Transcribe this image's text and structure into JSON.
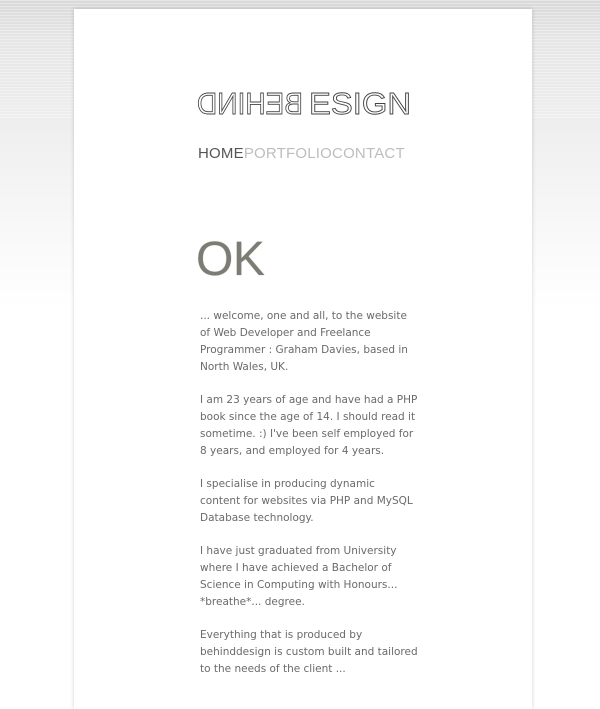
{
  "logo": {
    "mirrored_part": "BEHIND",
    "normal_part": "ESIGN"
  },
  "nav": {
    "items": [
      {
        "label": "HOME",
        "active": true
      },
      {
        "label": "PORTFOLIO",
        "active": false
      },
      {
        "label": "CONTACT",
        "active": false
      }
    ]
  },
  "main": {
    "heading": "OK",
    "paragraphs": [
      "... welcome, one and all, to the website of Web Developer and Freelance Programmer : Graham Davies, based in North Wales, UK.",
      "I am 23 years of age and have had a PHP book since the age of 14. I should read it sometime. :) I've been self employed for 8 years, and employed for 4 years.",
      "I specialise in producing dynamic content for websites via PHP and MySQL Database technology.",
      "I have just graduated from University where I have achieved a Bachelor of Science in Computing with Honours... *breathe*... degree.",
      "Everything that is produced by behinddesign is custom built and tailored to the needs of the client ..."
    ]
  },
  "colors": {
    "nav_active": "#555555",
    "nav_inactive": "#bdbdbd",
    "heading": "#7c7c74",
    "body_text": "#6a6a6a"
  }
}
